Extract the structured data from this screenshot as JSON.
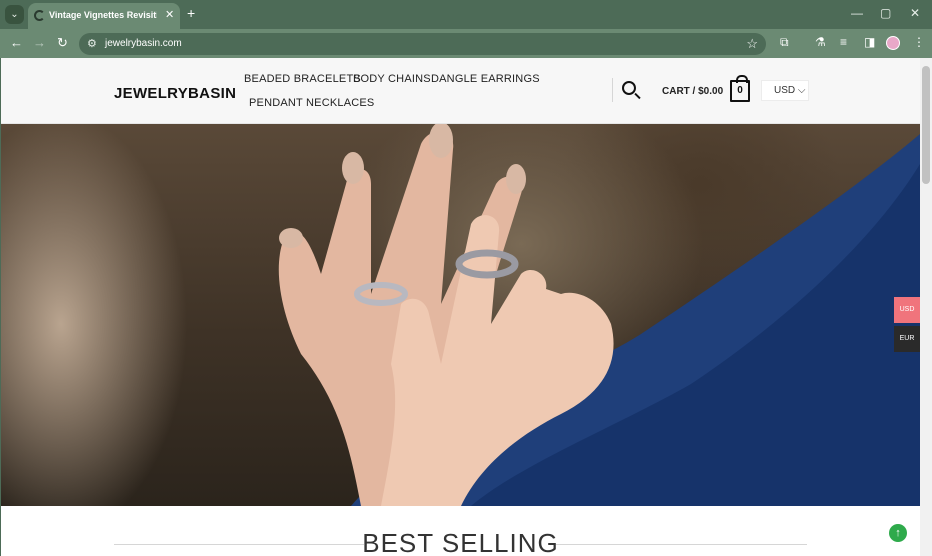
{
  "browser": {
    "tab_title": "Vintage Vignettes Revisiting C",
    "url": "jewelrybasin.com"
  },
  "site": {
    "logo": "JEWELRYBASIN",
    "nav": [
      "BEADED BRACELETS",
      "BODY CHAINS",
      "DANGLE EARRINGS",
      "PENDANT NECKLACES"
    ],
    "cart_label": "CART / $0.00",
    "cart_count": "0",
    "currency_selected": "USD",
    "section_title": "BEST SELLING"
  },
  "currency_switcher": {
    "options": [
      "USD",
      "EUR"
    ],
    "active_color": "#f0747c",
    "inactive_color": "#2a2a2a"
  },
  "colors": {
    "browser_frame": "#4d6b57",
    "toolbar": "#6b8a73",
    "scroll_to_top": "#2eaa4b"
  },
  "icons": {
    "tab_search": "chevron-down-icon",
    "back": "arrow-left-icon",
    "forward": "arrow-right-icon",
    "reload": "reload-icon",
    "bookmark": "star-icon",
    "search": "search-icon",
    "cart": "shopping-bag-icon",
    "scroll_top": "arrow-up-icon"
  }
}
